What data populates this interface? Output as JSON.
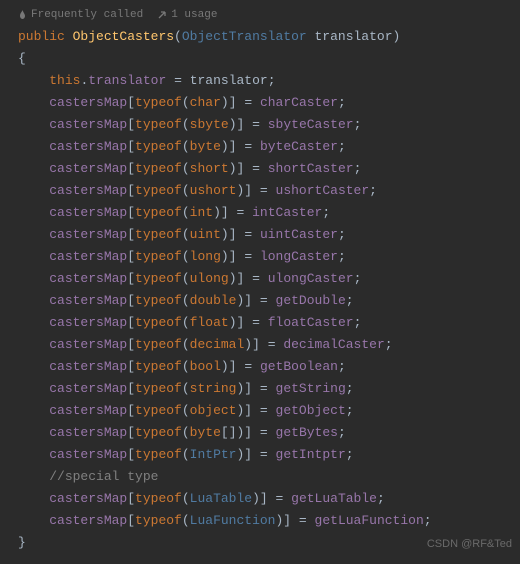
{
  "header": {
    "freq_label": "Frequently called",
    "usage_label": "1 usage"
  },
  "sig": {
    "access": "public",
    "name": "ObjectCasters",
    "param_type": "ObjectTranslator",
    "param_name": "translator"
  },
  "assign": {
    "this_kw": "this",
    "field": "translator",
    "rhs": "translator"
  },
  "map_field": "castersMap",
  "typeof_kw": "typeof",
  "lines": [
    {
      "t": "char",
      "arr": "",
      "rhs": "charCaster"
    },
    {
      "t": "sbyte",
      "arr": "",
      "rhs": "sbyteCaster"
    },
    {
      "t": "byte",
      "arr": "",
      "rhs": "byteCaster"
    },
    {
      "t": "short",
      "arr": "",
      "rhs": "shortCaster"
    },
    {
      "t": "ushort",
      "arr": "",
      "rhs": "ushortCaster"
    },
    {
      "t": "int",
      "arr": "",
      "rhs": "intCaster"
    },
    {
      "t": "uint",
      "arr": "",
      "rhs": "uintCaster"
    },
    {
      "t": "long",
      "arr": "",
      "rhs": "longCaster"
    },
    {
      "t": "ulong",
      "arr": "",
      "rhs": "ulongCaster"
    },
    {
      "t": "double",
      "arr": "",
      "rhs": "getDouble"
    },
    {
      "t": "float",
      "arr": "",
      "rhs": "floatCaster"
    },
    {
      "t": "decimal",
      "arr": "",
      "rhs": "decimalCaster"
    },
    {
      "t": "bool",
      "arr": "",
      "rhs": "getBoolean"
    },
    {
      "t": "string",
      "arr": "",
      "rhs": "getString"
    },
    {
      "t": "object",
      "arr": "",
      "rhs": "getObject"
    },
    {
      "t": "byte",
      "arr": "[]",
      "rhs": "getBytes"
    },
    {
      "t": "IntPtr",
      "arr": "",
      "rhs": "getIntptr"
    }
  ],
  "comment": "//special type",
  "special": [
    {
      "t": "LuaTable",
      "rhs": "getLuaTable"
    },
    {
      "t": "LuaFunction",
      "rhs": "getLuaFunction"
    }
  ],
  "watermark": "CSDN @RF&Ted"
}
